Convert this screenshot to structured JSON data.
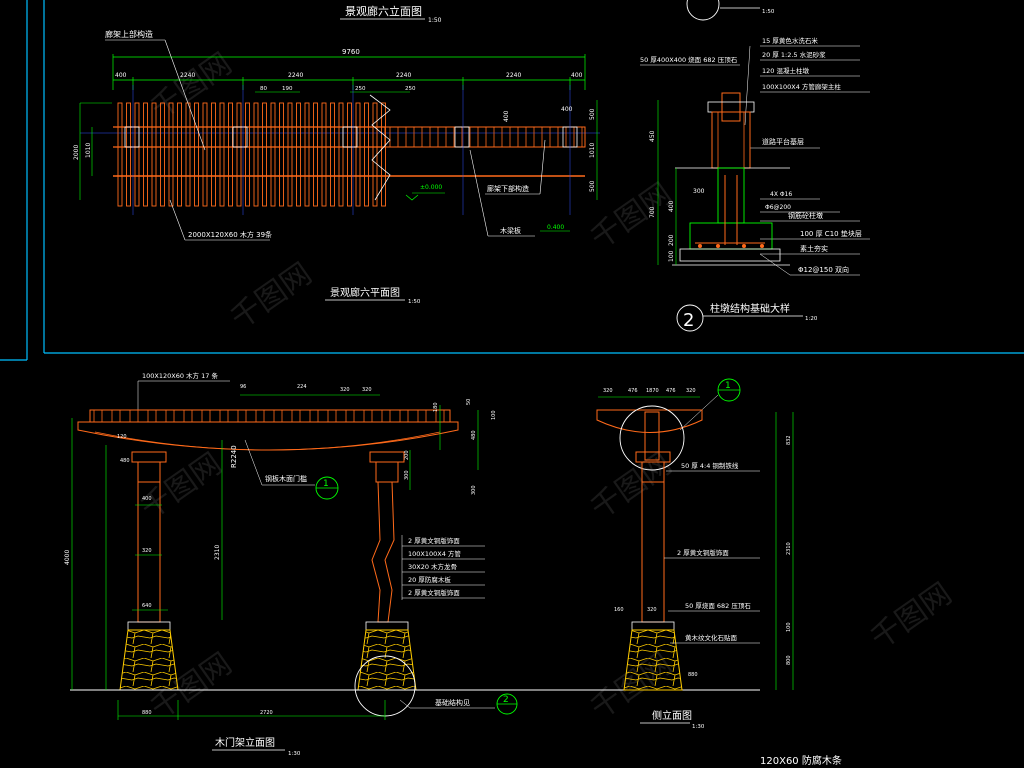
{
  "colors": {
    "background": "#000000",
    "structure": "#ff6a1a",
    "dimension": "#00ff00",
    "text": "#ffffff",
    "frame": "#00bfff",
    "stone": "#ffcc00"
  },
  "icons": [
    "section-marker-circle",
    "stone-masonry-hatch"
  ],
  "watermark": "千图网",
  "views": {
    "top_elevation": {
      "title": "景观廊六立面图",
      "scale": "1:50",
      "label_top_structure": "廊架上部构造",
      "label_bottom_structure": "廊架下部构造",
      "label_wood_beam": "木梁板",
      "label_slats": "2000X120X60  木方 39条",
      "dims_top": [
        "400",
        "2240",
        "2240",
        "2240",
        "2240",
        "400"
      ],
      "dim_total": "9760",
      "dims_small": [
        "80",
        "190",
        "250",
        "250"
      ],
      "dims_right": [
        "500",
        "1010",
        "500",
        "400"
      ],
      "dim_height": "2000",
      "dim_height2": "1010",
      "level_mark": "±0.000",
      "level_mark2": "0.400",
      "plan_title": "景观廊六平面图",
      "plan_scale": "1:50"
    },
    "foundation_detail": {
      "marker": "2",
      "title": "柱墩结构基础大样",
      "scale": "1:20",
      "top_marker_scale": "1:50",
      "labels": [
        "50 厚400X400  烧面 682 压顶石",
        "15 厚黄色水洗石米",
        "20 厚 1:2.5 水泥砂浆",
        "120 混凝土柱墩",
        "100X100X4  方管廊架主柱",
        "道路平台基层",
        "4X Φ16",
        "Φ6@200",
        "钢筋砼柱墩",
        "100 厚 C10 垫块层",
        "素土夯实",
        "Φ12@150 双向"
      ],
      "dims": [
        "450",
        "300",
        "400",
        "700",
        "200",
        "100"
      ]
    },
    "gate_elevation": {
      "title": "木门架立面图",
      "scale": "1:30",
      "top_label": "100X120X60 木方 17 条",
      "arc_label": "R2240",
      "label_iron_plate": "钢板木面门槛",
      "section_marker": "1",
      "detail_labels": [
        "2 厚黄文铜版饰面",
        "100X100X4  方管",
        "30X20  木方龙骨",
        "20 厚防腐木板",
        "2 厚黄文铜版饰面"
      ],
      "foundation_label": "基础结构见",
      "foundation_marker": "2",
      "dims_top": [
        "96",
        "224",
        "320",
        "320"
      ],
      "dims_left": [
        "120",
        "480",
        "400",
        "320",
        "640"
      ],
      "dim_height": "4000",
      "dim_mid": "2310",
      "dims_bottom": [
        "880",
        "2720"
      ],
      "dims_right": [
        "180",
        "480",
        "200",
        "300",
        "50",
        "100"
      ]
    },
    "side_elevation": {
      "title": "侧立面图",
      "scale": "1:30",
      "section_marker": "1",
      "dims_top": [
        "320",
        "476",
        "1870",
        "476",
        "320"
      ],
      "labels": [
        "50 厚 4:4 铜制铁线",
        "2 厚黄文铜版饰面",
        "50 厚烧面 682 压顶石",
        "黄木纹文化石贴面"
      ],
      "dims_left": [
        "160",
        "320"
      ],
      "dims_right": [
        "832",
        "2310",
        "100",
        "800"
      ],
      "dim_bottom": "880"
    },
    "bottom_note": {
      "text": "120X60  防腐木条"
    }
  }
}
